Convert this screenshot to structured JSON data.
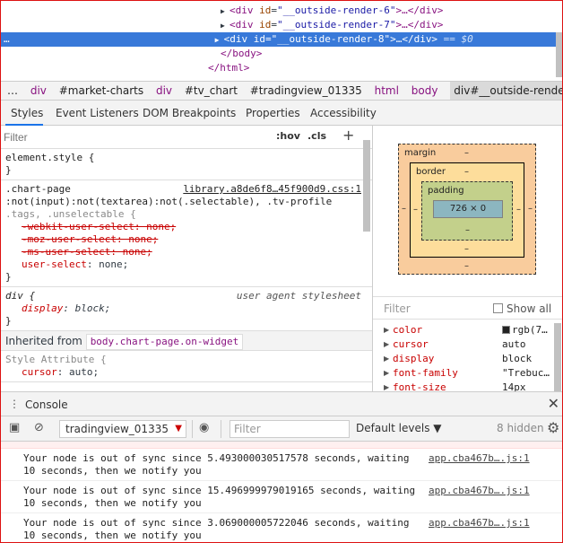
{
  "dom_tree": {
    "lines": [
      {
        "tag_open": "<div",
        "attr": "id",
        "value": "\"__outside-render-6\"",
        "rest": ">…</div>"
      },
      {
        "tag_open": "<div",
        "attr": "id",
        "value": "\"__outside-render-7\"",
        "rest": ">…</div>"
      },
      {
        "tag_open": "<div",
        "attr": "id",
        "value": "\"__outside-render-8\"",
        "rest": ">…</div>",
        "suffix": " == $0",
        "gutter": "…"
      },
      {
        "text": "</body>"
      },
      {
        "text": "</html>"
      }
    ]
  },
  "breadcrumb": [
    "…",
    "div",
    "#market-charts",
    "div",
    "#tv_chart",
    "#tradingview_01335",
    "html",
    "body",
    "div#__outside-render-8"
  ],
  "sidebar_tabs": [
    "Styles",
    "Event Listeners",
    "DOM Breakpoints",
    "Properties",
    "Accessibility"
  ],
  "styles": {
    "filter_placeholder": "Filter",
    "hov": ":hov",
    "cls": ".cls",
    "add": "+",
    "element_style": {
      "selector": "element.style {",
      "close": "}"
    },
    "rule1": {
      "selector_line1": ".chart-page",
      "selector_line2": ":not(input):not(textarea):not(.selectable), .tv-profile",
      "selector_line3": ".tags, .unselectable {",
      "source": "library.a8de6f8…45f900d9.css:1",
      "struck": [
        "-webkit-user-select: none;",
        "-moz-user-select: none;",
        "-ms-user-select: none;"
      ],
      "prop_name": "user-select",
      "prop_value": "none;",
      "close": "}"
    },
    "rule2": {
      "selector": "div {",
      "source": "user agent stylesheet",
      "prop_name": "display",
      "prop_value": "block;",
      "close": "}"
    },
    "inherited_label": "Inherited from",
    "inherited_from": "body.chart-page.on-widget",
    "rule3": {
      "selector": "Style Attribute {",
      "prop_name": "cursor",
      "prop_value": "auto;"
    }
  },
  "box_model": {
    "margin_label": "margin",
    "border_label": "border",
    "padding_label": "padding",
    "content_size": "726 × 0",
    "dash": "–"
  },
  "computed": {
    "filter_placeholder": "Filter",
    "show_all": "Show all",
    "props": [
      {
        "name": "color",
        "value": "rgb(7…",
        "swatch": "#222222"
      },
      {
        "name": "cursor",
        "value": "auto"
      },
      {
        "name": "display",
        "value": "block"
      },
      {
        "name": "font-family",
        "value": "\"Trebuc…"
      },
      {
        "name": "font-size",
        "value": "14px"
      }
    ]
  },
  "console": {
    "tab": "Console",
    "context": "tradingview_01335",
    "filter_placeholder": "Filter",
    "levels": "Default levels ▼",
    "hidden": "8 hidden",
    "messages": [
      {
        "text": "Your node is out of sync since 5.493000030517578 seconds, waiting\n10 seconds, then we notify you",
        "link": "app.cba467b….js:1"
      },
      {
        "text": "Your node is out of sync since 15.496999979019165 seconds, waiting\n10 seconds, then we notify you",
        "link": "app.cba467b….js:1"
      },
      {
        "text": "Your node is out of sync since 3.069000005722046 seconds, waiting\n10 seconds, then we notify you",
        "link": "app.cba467b….js:1"
      }
    ]
  },
  "colors": {
    "selection": "#3879d9",
    "accent_tab": "#1a73e8",
    "frame": "#dd1111"
  }
}
